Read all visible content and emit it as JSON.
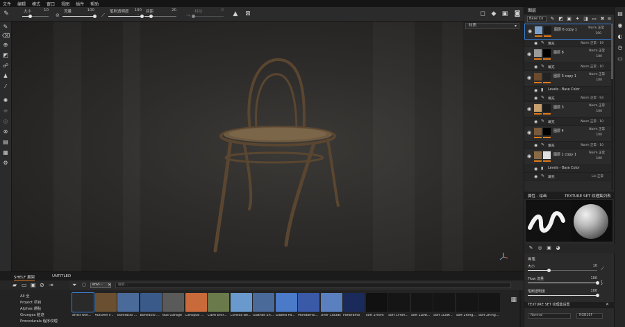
{
  "menu": [
    "文件",
    "编辑",
    "模式",
    "窗口",
    "视图",
    "插件",
    "帮助"
  ],
  "toolbar": {
    "size_label": "大小",
    "size_value": "10",
    "size_level": 0.3,
    "flow_label": "流量",
    "flow_value": "100",
    "flow_level": 1.0,
    "stroke_opacity_label": "笔刷透明度",
    "stroke_opacity_value": "100",
    "stroke_opacity_level": 1.0,
    "spacing_label": "间距",
    "spacing_value": "20",
    "spacing_level": 0.2,
    "jitter_label": "抖动",
    "jitter_value": "0",
    "jitter_level": 0.0
  },
  "viewport": {
    "dropdown_label": "材质"
  },
  "layers": {
    "title": "图层",
    "channel": "Base Co",
    "rows": [
      {
        "kind": "layer",
        "name": "图层 6 copy 1",
        "blend": "Norm 正常",
        "opacity": "100",
        "selected": true,
        "thumb": "#7aa0c8",
        "mask": "#1a1a1a"
      },
      {
        "kind": "sub",
        "name": "填充",
        "blend": "Norm 正常 · 19",
        "icon": "brush"
      },
      {
        "kind": "layer",
        "name": "图层 8",
        "blend": "Norm 正常",
        "opacity": "100",
        "selected": false,
        "thumb": "#9a9a9a",
        "mask": "#000000"
      },
      {
        "kind": "sub",
        "name": "填充",
        "blend": "Norm 正常 · 10",
        "icon": "brush"
      },
      {
        "kind": "layer",
        "name": "图层 3 copy 1",
        "blend": "Norm 正常",
        "opacity": "100",
        "selected": false,
        "thumb": "#6b4a2e",
        "mask": "#222222"
      },
      {
        "kind": "sub",
        "name": "Levels - Base Color",
        "blend": "",
        "icon": "levels"
      },
      {
        "kind": "sub",
        "name": "填充",
        "blend": "Norm 正常 · 93",
        "icon": "brush"
      },
      {
        "kind": "layer",
        "name": "图层 3",
        "blend": "Norm 正常",
        "opacity": "100",
        "selected": false,
        "thumb": "#c8a070",
        "mask": "#1a1a1a"
      },
      {
        "kind": "sub",
        "name": "填充",
        "blend": "Norm 正常 · 10",
        "icon": "brush"
      },
      {
        "kind": "layer",
        "name": "图层 4",
        "blend": "Norm 正常",
        "opacity": "100",
        "selected": false,
        "thumb": "#7a5a3a",
        "mask": "#000000"
      },
      {
        "kind": "sub",
        "name": "填充",
        "blend": "Norm 正常 · 10",
        "icon": "brush"
      },
      {
        "kind": "layer",
        "name": "图层 1 copy 1",
        "blend": "Norm 正常",
        "opacity": "100",
        "selected": false,
        "thumb": "#8a6a45",
        "mask": "#e0e0e0"
      },
      {
        "kind": "sub",
        "name": "Levels - Base Color",
        "blend": "",
        "icon": "levels"
      },
      {
        "kind": "sub",
        "name": "填充",
        "blend": "Lin 正常",
        "icon": "brush"
      }
    ]
  },
  "properties": {
    "tab1": "属性 - 绘画",
    "tab2": "TEXTURE SET 纹理集列表",
    "section": "画笔",
    "size_label": "大小",
    "size_value": "10",
    "size_level": 0.3,
    "flow_label": "Flow 流量",
    "flow_value": "100",
    "flow_level": 1.0,
    "opacity_label": "笔刷透明度",
    "opacity_value": "100",
    "opacity_level": 1.0,
    "texset_title": "TEXTURE SET 纹理集设置",
    "normal_field": "Normal",
    "format_field": "RGB16F"
  },
  "shelf": {
    "tab_shelf": "SHELF 展架",
    "tab_untitled": "UNTITLED",
    "chip": "envi···",
    "search_placeholder": "搜索...",
    "categories": [
      "All 全",
      "Project 项目",
      "Alphas 通贴",
      "Grunges 脏迹",
      "Procedurals 程序纹理"
    ],
    "items": [
      {
        "label": "artist wor...",
        "color": "#2a2a2a",
        "sel": true
      },
      {
        "label": "Autumn F...",
        "color": "#6a5030"
      },
      {
        "label": "Bonifacio ...",
        "color": "#4a6a9a"
      },
      {
        "label": "Bonifacio ...",
        "color": "#3a5a8a"
      },
      {
        "label": "Bus Garage",
        "color": "#5a5a5a"
      },
      {
        "label": "Canopus ...",
        "color": "#c86a3a"
      },
      {
        "label": "Cave Entr...",
        "color": "#6a7a4a"
      },
      {
        "label": "Corsica Be...",
        "color": "#6a9acd"
      },
      {
        "label": "Gdansk Sh...",
        "color": "#4a6a9a"
      },
      {
        "label": "Glazed Pa...",
        "color": "#4a7ac8"
      },
      {
        "label": "Mondarrai...",
        "color": "#3a5aa8"
      },
      {
        "label": "Over Clouds",
        "color": "#5a80c0"
      },
      {
        "label": "Panorama",
        "color": "#1a2a5a"
      },
      {
        "label": "Soft 1Front",
        "color": "#111111"
      },
      {
        "label": "Soft 1Fron...",
        "color": "#151515"
      },
      {
        "label": "Soft 1Low...",
        "color": "#151515"
      },
      {
        "label": "Soft 1Low...",
        "color": "#151515"
      },
      {
        "label": "Soft 2Ring...",
        "color": "#151515"
      },
      {
        "label": "Soft 2Ring...",
        "color": "#151515"
      }
    ]
  },
  "colors": {
    "accent": "#e07a1b",
    "selection": "#3a7fd5"
  }
}
